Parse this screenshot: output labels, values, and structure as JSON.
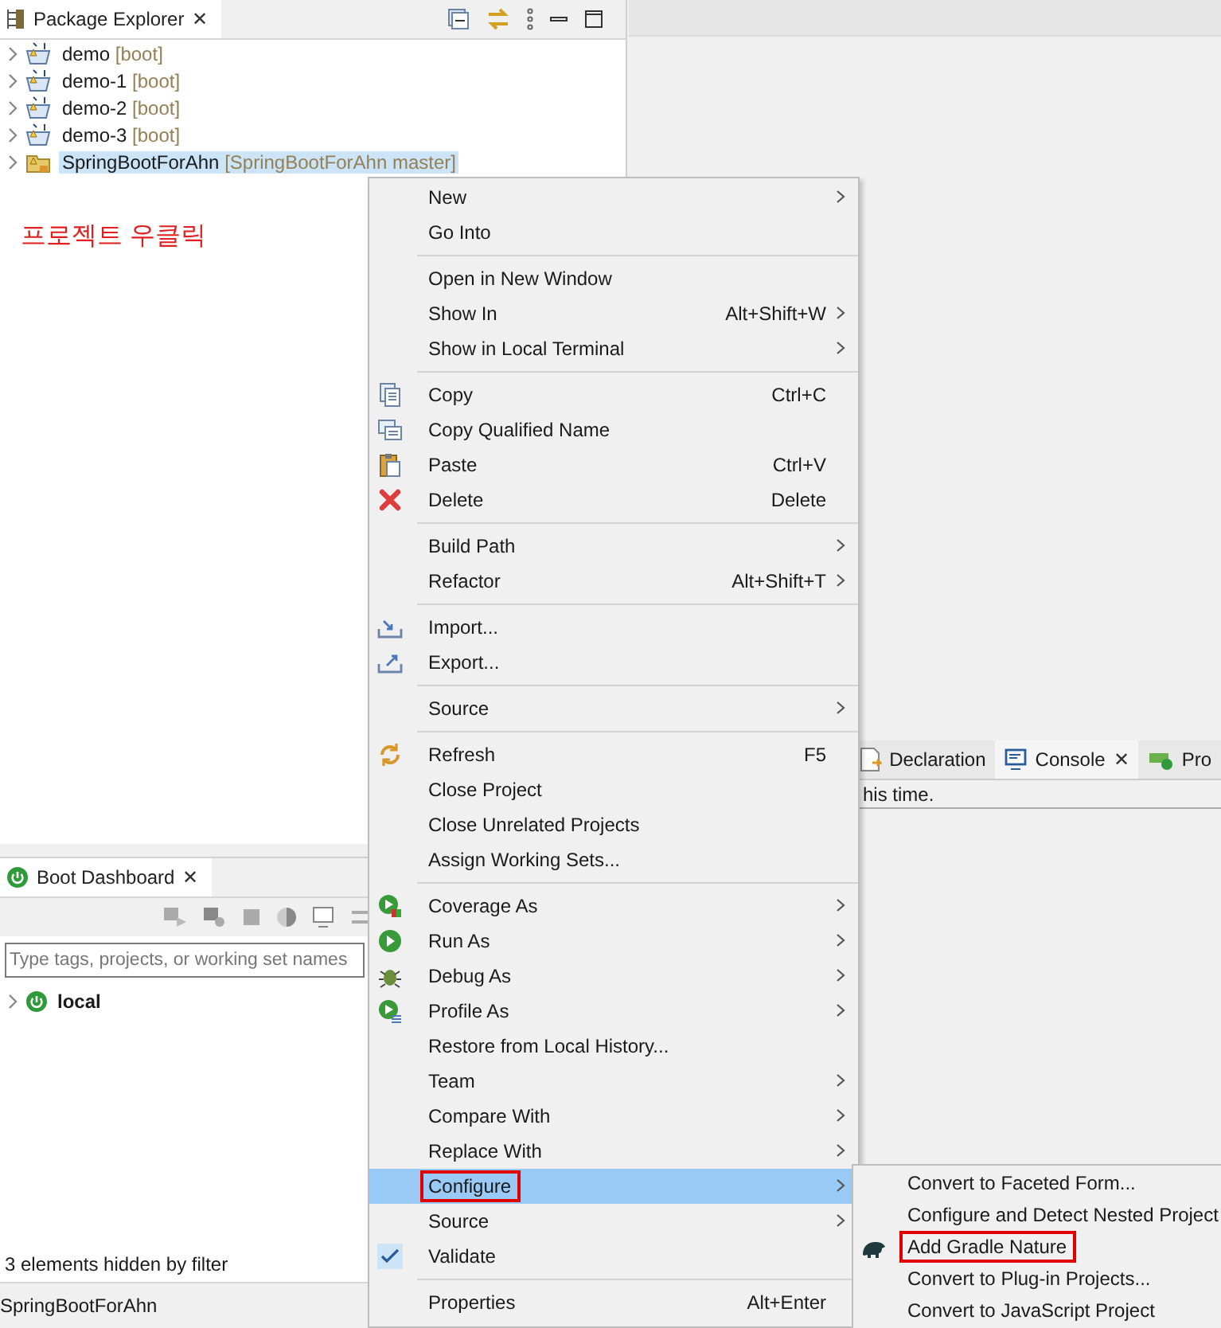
{
  "package_explorer": {
    "tab": {
      "label": "Package Explorer",
      "close": "✕",
      "selected": true
    },
    "items": [
      {
        "label": "demo",
        "decoration": "[boot]",
        "kind": "boot",
        "selected": false,
        "expanded": false
      },
      {
        "label": "demo-1",
        "decoration": "[boot]",
        "kind": "boot",
        "selected": false,
        "expanded": false
      },
      {
        "label": "demo-2",
        "decoration": "[boot]",
        "kind": "boot",
        "selected": false,
        "expanded": false
      },
      {
        "label": "demo-3",
        "decoration": "[boot]",
        "kind": "boot",
        "selected": false,
        "expanded": false
      },
      {
        "label": "SpringBootForAhn",
        "decoration": "[SpringBootForAhn master]",
        "kind": "git",
        "selected": true,
        "expanded": false
      }
    ],
    "annotation": "프로젝트 우클릭"
  },
  "boot_dashboard": {
    "tab": {
      "label": "Boot Dashboard",
      "close": "✕",
      "selected": true
    },
    "search": {
      "placeholder": "Type tags, projects, or working set names"
    },
    "items": [
      {
        "label": "local",
        "expanded": false
      }
    ],
    "filter_note": "3 elements hidden by filter"
  },
  "status_bar": "SpringBootForAhn",
  "console": {
    "tabs": [
      {
        "label": "Declaration",
        "kind": "declaration",
        "selected": false
      },
      {
        "label": "Console",
        "kind": "console",
        "close": "✕",
        "selected": true
      },
      {
        "label": "Pro",
        "kind": "progress",
        "selected": false
      }
    ],
    "text": "his time."
  },
  "context_menu": [
    {
      "kind": "plain",
      "label": "New",
      "submenu": true,
      "selected": false,
      "outlined": false
    },
    {
      "kind": "plain",
      "label": "Go Into",
      "submenu": false,
      "selected": false,
      "outlined": false
    },
    {
      "kind": "separator"
    },
    {
      "kind": "plain",
      "label": "Open in New Window",
      "submenu": false,
      "selected": false,
      "outlined": false
    },
    {
      "kind": "plain",
      "label": "Show In",
      "shortcut": "Alt+Shift+W",
      "submenu": true,
      "selected": false,
      "outlined": false
    },
    {
      "kind": "plain",
      "label": "Show in Local Terminal",
      "submenu": true,
      "selected": false,
      "outlined": false
    },
    {
      "kind": "separator"
    },
    {
      "kind": "copy",
      "label": "Copy",
      "shortcut": "Ctrl+C",
      "submenu": false,
      "selected": false,
      "outlined": false
    },
    {
      "kind": "copyname",
      "label": "Copy Qualified Name",
      "submenu": false,
      "selected": false,
      "outlined": false
    },
    {
      "kind": "paste",
      "label": "Paste",
      "shortcut": "Ctrl+V",
      "submenu": false,
      "selected": false,
      "outlined": false
    },
    {
      "kind": "delete",
      "label": "Delete",
      "shortcut": "Delete",
      "submenu": false,
      "selected": false,
      "outlined": false
    },
    {
      "kind": "separator"
    },
    {
      "kind": "plain",
      "label": "Build Path",
      "submenu": true,
      "selected": false,
      "outlined": false
    },
    {
      "kind": "plain",
      "label": "Refactor",
      "shortcut": "Alt+Shift+T",
      "submenu": true,
      "selected": false,
      "outlined": false
    },
    {
      "kind": "separator"
    },
    {
      "kind": "import",
      "label": "Import...",
      "submenu": false,
      "selected": false,
      "outlined": false
    },
    {
      "kind": "export",
      "label": "Export...",
      "submenu": false,
      "selected": false,
      "outlined": false
    },
    {
      "kind": "separator"
    },
    {
      "kind": "plain",
      "label": "Source",
      "submenu": true,
      "selected": false,
      "outlined": false
    },
    {
      "kind": "separator"
    },
    {
      "kind": "refresh",
      "label": "Refresh",
      "shortcut": "F5",
      "submenu": false,
      "selected": false,
      "outlined": false
    },
    {
      "kind": "plain",
      "label": "Close Project",
      "submenu": false,
      "selected": false,
      "outlined": false
    },
    {
      "kind": "plain",
      "label": "Close Unrelated Projects",
      "submenu": false,
      "selected": false,
      "outlined": false
    },
    {
      "kind": "plain",
      "label": "Assign Working Sets...",
      "submenu": false,
      "selected": false,
      "outlined": false
    },
    {
      "kind": "separator"
    },
    {
      "kind": "coverage",
      "label": "Coverage As",
      "submenu": true,
      "selected": false,
      "outlined": false
    },
    {
      "kind": "run",
      "label": "Run As",
      "submenu": true,
      "selected": false,
      "outlined": false
    },
    {
      "kind": "debug",
      "label": "Debug As",
      "submenu": true,
      "selected": false,
      "outlined": false
    },
    {
      "kind": "profile",
      "label": "Profile As",
      "submenu": true,
      "selected": false,
      "outlined": false
    },
    {
      "kind": "plain",
      "label": "Restore from Local History...",
      "submenu": false,
      "selected": false,
      "outlined": false
    },
    {
      "kind": "plain",
      "label": "Team",
      "submenu": true,
      "selected": false,
      "outlined": false
    },
    {
      "kind": "plain",
      "label": "Compare With",
      "submenu": true,
      "selected": false,
      "outlined": false
    },
    {
      "kind": "plain",
      "label": "Replace With",
      "submenu": true,
      "selected": false,
      "outlined": false
    },
    {
      "kind": "plain",
      "label": "Configure",
      "submenu": true,
      "selected": true,
      "outlined": true
    },
    {
      "kind": "plain",
      "label": "Source",
      "submenu": true,
      "selected": false,
      "outlined": false
    },
    {
      "kind": "check",
      "label": "Validate",
      "checked": true
    },
    {
      "kind": "separator"
    },
    {
      "kind": "plain",
      "label": "Properties",
      "shortcut": "Alt+Enter",
      "submenu": false,
      "selected": false,
      "outlined": false
    }
  ],
  "configure_submenu": [
    {
      "kind": "plain",
      "label": "Convert to Faceted Form...",
      "selected": false,
      "outlined": false
    },
    {
      "kind": "plain",
      "label": "Configure and Detect Nested Project",
      "selected": false,
      "outlined": false
    },
    {
      "kind": "gradle",
      "label": "Add Gradle Nature",
      "selected": false,
      "outlined": true
    },
    {
      "kind": "plain",
      "label": "Convert to Plug-in Projects...",
      "selected": false,
      "outlined": false
    },
    {
      "kind": "plain",
      "label": "Convert to JavaScript Project",
      "selected": false,
      "outlined": false
    }
  ]
}
